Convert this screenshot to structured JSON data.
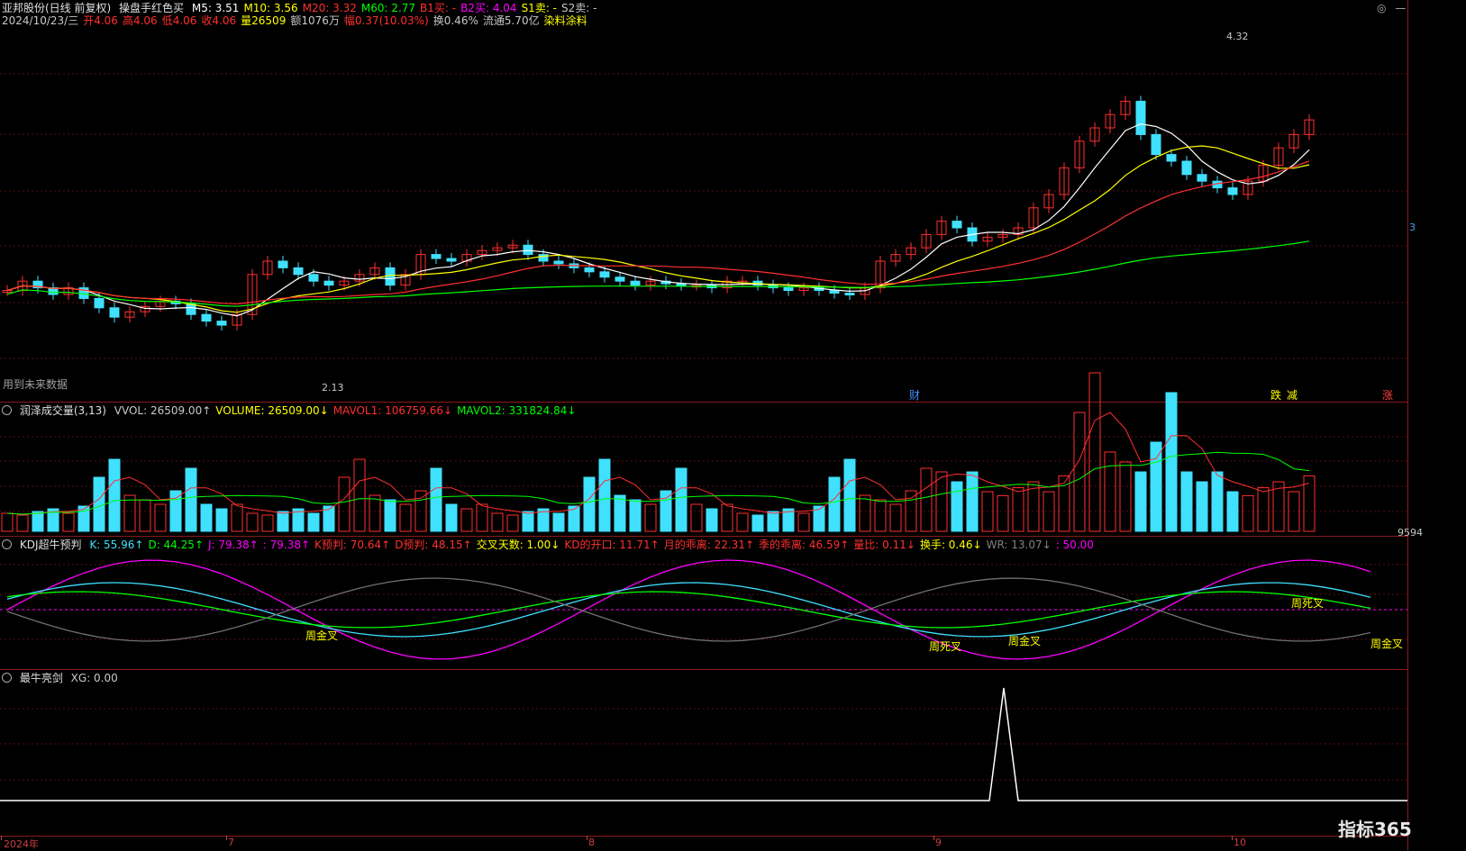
{
  "main": {
    "stock": "亚邦股份(日线 前复权)",
    "indicator": "操盘手红色买",
    "ma": [
      {
        "label": "M5: 3.51",
        "color": "#ffffff"
      },
      {
        "label": "M10: 3.56",
        "color": "#ffff00"
      },
      {
        "label": "M20: 3.32",
        "color": "#ff3030"
      },
      {
        "label": "M60: 2.77",
        "color": "#00ff00"
      },
      {
        "label": "B1买: -",
        "color": "#ff3030"
      },
      {
        "label": "B2买: 4.04",
        "color": "#ff00ff"
      },
      {
        "label": "S1卖: -",
        "color": "#ffff00"
      },
      {
        "label": "S2卖: -",
        "color": "#c8c8c8"
      }
    ],
    "info_line": [
      {
        "label": "2024/10/23/三",
        "color": "#c8c8c8"
      },
      {
        "label": "开4.06",
        "color": "#ff3030"
      },
      {
        "label": "高4.06",
        "color": "#ff3030"
      },
      {
        "label": "低4.06",
        "color": "#ff3030"
      },
      {
        "label": "收4.06",
        "color": "#ff3030"
      },
      {
        "label": "量26509",
        "color": "#ffff00"
      },
      {
        "label": "额1076万",
        "color": "#c8c8c8"
      },
      {
        "label": "幅0.37(10.03%)",
        "color": "#ff3030"
      },
      {
        "label": "换0.46%",
        "color": "#c8c8c8"
      },
      {
        "label": "流通5.70亿",
        "color": "#c8c8c8"
      },
      {
        "label": "染料涂料",
        "color": "#ffff00"
      }
    ],
    "note": "用到未来数据",
    "high_label": "4.32",
    "low_label": "2.13",
    "right_label": "3",
    "event_tags": [
      {
        "text": "财",
        "color": "#4090ff"
      },
      {
        "text": "跌",
        "color": "#ffff00"
      },
      {
        "text": "减",
        "color": "#ffff00"
      },
      {
        "text": "涨",
        "color": "#ff4040"
      }
    ]
  },
  "volume": {
    "name": "润泽成交量(3,13)",
    "fields": [
      {
        "label": "VVOL: 26509.00↑",
        "color": "#c8c8c8"
      },
      {
        "label": "VOLUME: 26509.00↓",
        "color": "#ffff00"
      },
      {
        "label": "MAVOL1: 106759.66↓",
        "color": "#ff3030"
      },
      {
        "label": "MAVOL2: 331824.84↓",
        "color": "#00ff00"
      }
    ],
    "right_label": "9594"
  },
  "kdj": {
    "name": "KDJ超牛预判",
    "fields": [
      {
        "label": "K: 55.96↑",
        "color": "#40e0ff"
      },
      {
        "label": "D: 44.25↑",
        "color": "#00ff00"
      },
      {
        "label": "J: 79.38↑",
        "color": "#ff00ff"
      },
      {
        "label": ": 79.38↑",
        "color": "#ff00ff"
      },
      {
        "label": "K预判: 70.64↑",
        "color": "#ff3030"
      },
      {
        "label": "D预判: 48.15↑",
        "color": "#ff3030"
      },
      {
        "label": "交叉天数: 1.00↓",
        "color": "#ffff00"
      },
      {
        "label": "KD的开口: 11.71↑",
        "color": "#ff3030"
      },
      {
        "label": "月的乖离: 22.31↑",
        "color": "#ff3030"
      },
      {
        "label": "季的乖离: 46.59↑",
        "color": "#ff3030"
      },
      {
        "label": "量比: 0.11↓",
        "color": "#ff3030"
      },
      {
        "label": "换手: 0.46↓",
        "color": "#ffff00"
      },
      {
        "label": "WR: 13.07↓",
        "color": "#808080"
      },
      {
        "label": ": 50.00",
        "color": "#ff00ff"
      }
    ],
    "tags": [
      {
        "text": "周金叉",
        "color": "#ffff00"
      },
      {
        "text": "周死叉",
        "color": "#ffff00"
      },
      {
        "text": "周金叉",
        "color": "#ffff00"
      },
      {
        "text": "周死叉",
        "color": "#ffff00"
      },
      {
        "text": "周金叉",
        "color": "#ffff00"
      }
    ]
  },
  "xg": {
    "name": "最牛亮剑",
    "fields": [
      {
        "label": "XG: 0.00",
        "color": "#c8c8c8"
      }
    ]
  },
  "xaxis": {
    "labels": [
      "2024年",
      "7",
      "8",
      "9",
      "10"
    ]
  },
  "brand": "指标365",
  "chart_data": [
    {
      "type": "candlestick",
      "title": "亚邦股份(日线 前复权)",
      "series": [
        {
          "name": "M5",
          "value": 3.51
        },
        {
          "name": "M10",
          "value": 3.56
        },
        {
          "name": "M20",
          "value": 3.32
        },
        {
          "name": "M60",
          "value": 2.77
        }
      ],
      "annotations": [
        "4.32",
        "2.13"
      ]
    },
    {
      "type": "bar",
      "title": "润泽成交量(3,13)",
      "series": [
        {
          "name": "VOLUME",
          "value": 26509.0
        },
        {
          "name": "MAVOL1",
          "value": 106759.66
        },
        {
          "name": "MAVOL2",
          "value": 331824.84
        }
      ]
    },
    {
      "type": "line",
      "title": "KDJ超牛预判",
      "series": [
        {
          "name": "K",
          "value": 55.96
        },
        {
          "name": "D",
          "value": 44.25
        },
        {
          "name": "J",
          "value": 79.38
        },
        {
          "name": "WR",
          "value": 13.07
        }
      ]
    },
    {
      "type": "line",
      "title": "最牛亮剑",
      "series": [
        {
          "name": "XG",
          "value": 0.0
        }
      ]
    }
  ]
}
